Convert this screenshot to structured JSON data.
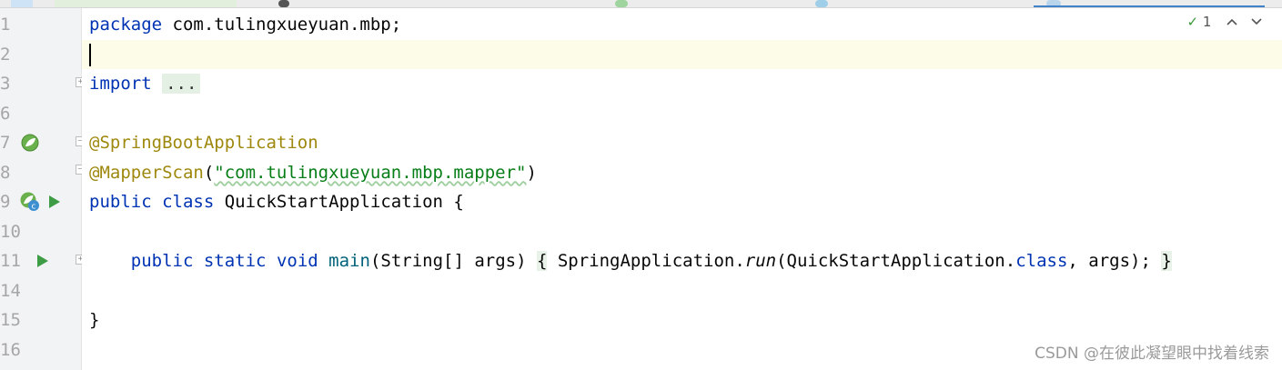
{
  "inspection": {
    "check_glyph": "✓",
    "count": "1"
  },
  "lines": [
    {
      "no": "1",
      "tokens": [
        {
          "t": "package",
          "c": "kw"
        },
        {
          "t": " com.tulingxueyuan.mbp;",
          "c": ""
        }
      ]
    },
    {
      "no": "2",
      "tokens": [],
      "current": true
    },
    {
      "no": "3",
      "tokens": [
        {
          "t": "import",
          "c": "kw"
        },
        {
          "t": " ",
          "c": ""
        },
        {
          "t": "...",
          "c": "folded"
        }
      ]
    },
    {
      "no": "6",
      "tokens": []
    },
    {
      "no": "7",
      "tokens": [
        {
          "t": "@SpringBootApplication",
          "c": "ann"
        }
      ]
    },
    {
      "no": "8",
      "tokens": [
        {
          "t": "@MapperScan",
          "c": "ann"
        },
        {
          "t": "(",
          "c": ""
        },
        {
          "t": "\"com.tulingxueyuan.mbp.mapper\"",
          "c": "str wavy"
        },
        {
          "t": ")",
          "c": ""
        }
      ]
    },
    {
      "no": "9",
      "tokens": [
        {
          "t": "public",
          "c": "kw"
        },
        {
          "t": " ",
          "c": ""
        },
        {
          "t": "class",
          "c": "kw"
        },
        {
          "t": " QuickStartApplication {",
          "c": ""
        }
      ]
    },
    {
      "no": "10",
      "tokens": []
    },
    {
      "no": "11",
      "tokens": [
        {
          "t": "    ",
          "c": ""
        },
        {
          "t": "public",
          "c": "kw"
        },
        {
          "t": " ",
          "c": ""
        },
        {
          "t": "static",
          "c": "kw"
        },
        {
          "t": " ",
          "c": ""
        },
        {
          "t": "void",
          "c": "kw"
        },
        {
          "t": " ",
          "c": ""
        },
        {
          "t": "main",
          "c": "fn"
        },
        {
          "t": "(String[] args) ",
          "c": ""
        },
        {
          "t": "{",
          "c": "fold"
        },
        {
          "t": " SpringApplication.",
          "c": ""
        },
        {
          "t": "run",
          "c": "it"
        },
        {
          "t": "(QuickStartApplication.",
          "c": ""
        },
        {
          "t": "class",
          "c": "kw"
        },
        {
          "t": ", args); ",
          "c": ""
        },
        {
          "t": "}",
          "c": "fold"
        }
      ]
    },
    {
      "no": "14",
      "tokens": []
    },
    {
      "no": "15",
      "tokens": [
        {
          "t": "}",
          "c": ""
        }
      ]
    },
    {
      "no": "16",
      "tokens": []
    }
  ],
  "watermark": "CSDN @在彼此凝望眼中找着线索",
  "colors": {
    "keyword": "#0033b3",
    "annotation": "#9e880d",
    "string": "#067d17",
    "method": "#00627a",
    "current_line": "#fdfce8",
    "gutter": "#f2f3f5"
  },
  "icons": [
    "spring-bean-icon",
    "spring-app-icon",
    "run-icon",
    "fold-icon",
    "inspection-check-icon",
    "arrow-up-icon",
    "arrow-down-icon"
  ]
}
